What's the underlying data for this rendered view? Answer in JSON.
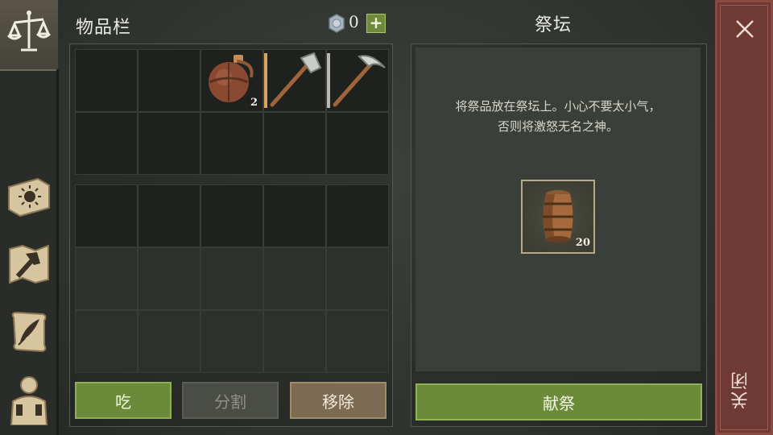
{
  "inventory": {
    "title": "物品栏",
    "currency": {
      "icon": "coin-icon",
      "count": "0",
      "add_label": "+"
    },
    "slots_top": [
      {
        "item": "",
        "count": ""
      },
      {
        "item": "",
        "count": ""
      },
      {
        "item": "flask",
        "count": "2"
      },
      {
        "item": "axe",
        "count": ""
      },
      {
        "item": "pickaxe",
        "count": ""
      },
      {
        "item": "",
        "count": ""
      },
      {
        "item": "",
        "count": ""
      },
      {
        "item": "",
        "count": ""
      },
      {
        "item": "",
        "count": ""
      },
      {
        "item": "",
        "count": ""
      }
    ],
    "buttons": {
      "eat": "吃",
      "split": "分割",
      "remove": "移除"
    }
  },
  "altar": {
    "title": "祭坛",
    "description_line1": "将祭品放在祭坛上。小心不要太小气，",
    "description_line2": "否则将激怒无名之神。",
    "offering": {
      "item": "barrel",
      "count": "20"
    },
    "offer_button": "献祭"
  },
  "close": {
    "label": "关闭"
  },
  "colors": {
    "accent_green": "#6b8a3a",
    "remove_brown": "#7d6a52",
    "close_red": "#6e3a33",
    "durability_bar": "#d4a55a"
  }
}
